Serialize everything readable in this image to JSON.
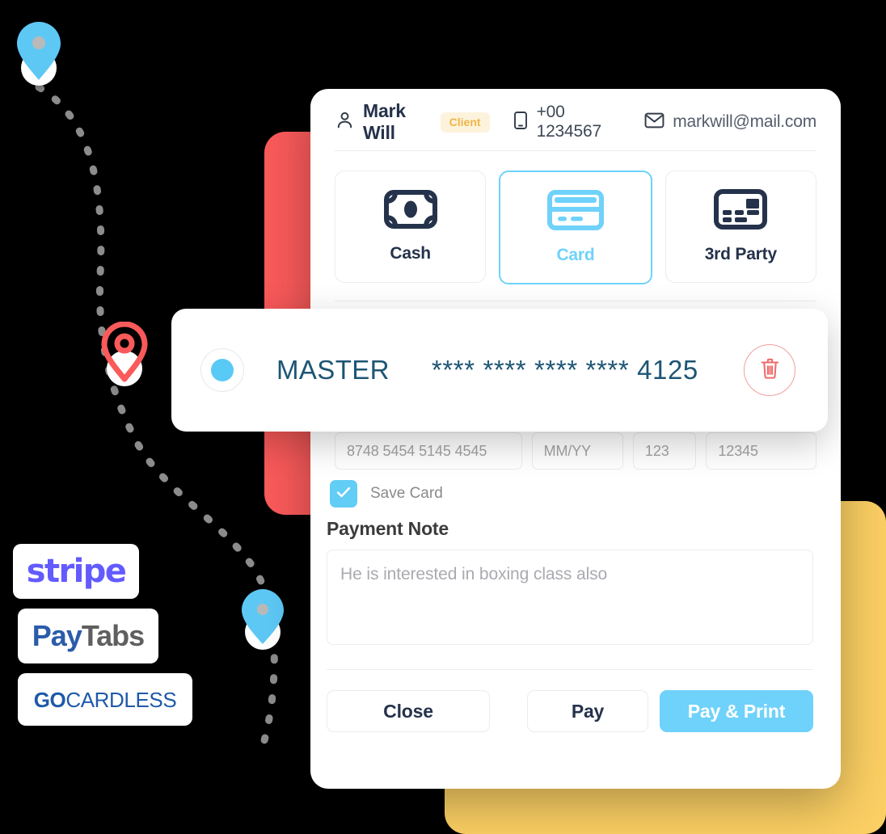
{
  "header": {
    "person_icon": "user-icon",
    "name": "Mark Will",
    "badge": "Client",
    "phone_icon": "mobile-icon",
    "phone": "+00 1234567",
    "email_icon": "envelope-icon",
    "email": "markwill@mail.com"
  },
  "methods": [
    {
      "id": "cash",
      "label": "Cash",
      "icon": "cash-banknote-icon",
      "selected": false
    },
    {
      "id": "card",
      "label": "Card",
      "icon": "credit-card-icon",
      "selected": true
    },
    {
      "id": "third-party",
      "label": "3rd Party",
      "icon": "third-party-card-icon",
      "selected": false
    }
  ],
  "saved_card": {
    "selected": true,
    "brand": "MASTER",
    "masked_number": "**** **** **** **** 4125",
    "delete_icon": "trash-icon"
  },
  "card_fields": {
    "number_placeholder": "8748 5454 5145 4545",
    "expiry_placeholder": "MM/YY",
    "cvv_placeholder": "123",
    "zip_placeholder": "12345"
  },
  "save_card": {
    "label": "Save Card",
    "checked": true,
    "check_icon": "check-icon"
  },
  "payment_note": {
    "title": "Payment Note",
    "placeholder": "He is interested in boxing class also"
  },
  "footer": {
    "close_label": "Close",
    "pay_label": "Pay",
    "pay_print_label": "Pay & Print"
  },
  "providers": [
    {
      "id": "stripe",
      "name": "stripe"
    },
    {
      "id": "paytabs",
      "name_a": "Pay",
      "name_b": "Tabs"
    },
    {
      "id": "gocardless",
      "name_a": "GO",
      "name_b": "CARDLESS"
    }
  ],
  "map": {
    "pins": [
      {
        "id": "pin-top",
        "color": "blue"
      },
      {
        "id": "pin-middle",
        "color": "red"
      },
      {
        "id": "pin-bottom",
        "color": "blue"
      }
    ],
    "route_icon": "dashed-route-line"
  },
  "colors": {
    "accent_blue": "#6fd2fa",
    "navy": "#25324b",
    "steel_blue": "#1d5574",
    "danger_red": "#ef6a6a",
    "badge_amber": "#eeb547",
    "card_red": "#fa5a5a",
    "card_yellow": "#fbcf63",
    "stripe_purple": "#635bff",
    "paytabs_blue": "#2a5caa",
    "gocardless_blue": "#1f5aa8"
  }
}
